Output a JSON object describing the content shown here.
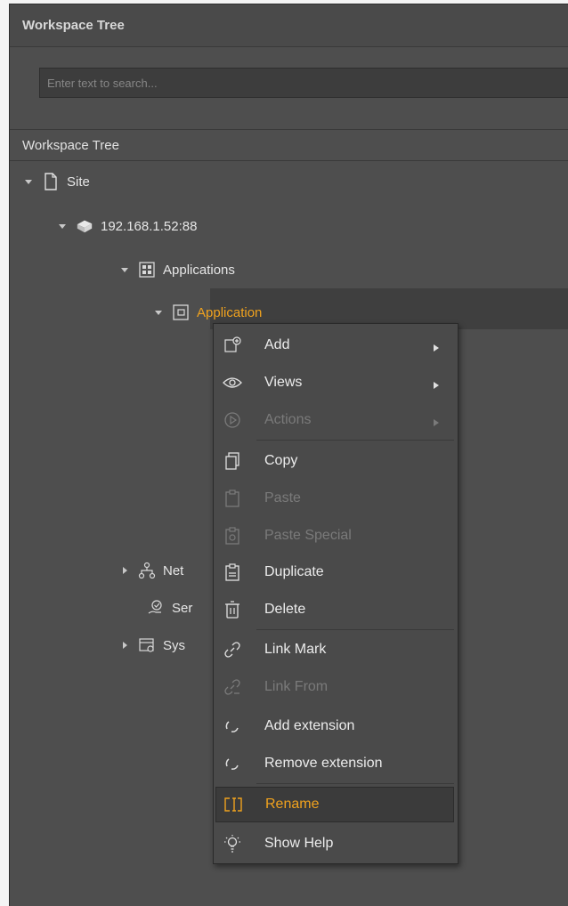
{
  "panel": {
    "title": "Workspace Tree",
    "search_placeholder": "Enter text to search..."
  },
  "tree": {
    "header": "Workspace Tree",
    "items": [
      {
        "label": "Site",
        "icon": "page-icon",
        "expanded": true
      },
      {
        "label": "192.168.1.52:88",
        "icon": "server-icon",
        "expanded": true
      },
      {
        "label": "Applications",
        "icon": "applications-icon",
        "expanded": true
      },
      {
        "label": "Application",
        "icon": "application-icon",
        "expanded": true,
        "selected": true
      },
      {
        "label": "Net",
        "icon": "network-icon",
        "expanded": false
      },
      {
        "label": "Ser",
        "icon": "services-icon"
      },
      {
        "label": "Sys",
        "icon": "system-icon",
        "expanded": false
      }
    ]
  },
  "context_menu": {
    "items": [
      {
        "label": "Add",
        "icon": "add-icon",
        "enabled": true,
        "submenu": true
      },
      {
        "label": "Views",
        "icon": "eye-icon",
        "enabled": true,
        "submenu": true
      },
      {
        "label": "Actions",
        "icon": "play-icon",
        "enabled": false,
        "submenu": true
      },
      {
        "label": "Copy",
        "icon": "copy-icon",
        "enabled": true
      },
      {
        "label": "Paste",
        "icon": "paste-icon",
        "enabled": false
      },
      {
        "label": "Paste Special",
        "icon": "paste-special-icon",
        "enabled": false
      },
      {
        "label": "Duplicate",
        "icon": "duplicate-icon",
        "enabled": true
      },
      {
        "label": "Delete",
        "icon": "trash-icon",
        "enabled": true
      },
      {
        "label": "Link Mark",
        "icon": "link-icon",
        "enabled": true
      },
      {
        "label": "Link From",
        "icon": "link-from-icon",
        "enabled": false
      },
      {
        "label": "Add extension",
        "icon": "extension-icon",
        "enabled": true
      },
      {
        "label": "Remove extension",
        "icon": "extension-icon",
        "enabled": true
      },
      {
        "label": "Rename",
        "icon": "rename-icon",
        "enabled": true,
        "highlighted": true
      },
      {
        "label": "Show Help",
        "icon": "help-bulb-icon",
        "enabled": true
      }
    ]
  },
  "colors": {
    "accent": "#f0a21e",
    "panel_bg": "#4e4e4e",
    "menu_bg": "#4a4a4a",
    "text": "#e6e6e6",
    "disabled_text": "#7a7a7a"
  }
}
